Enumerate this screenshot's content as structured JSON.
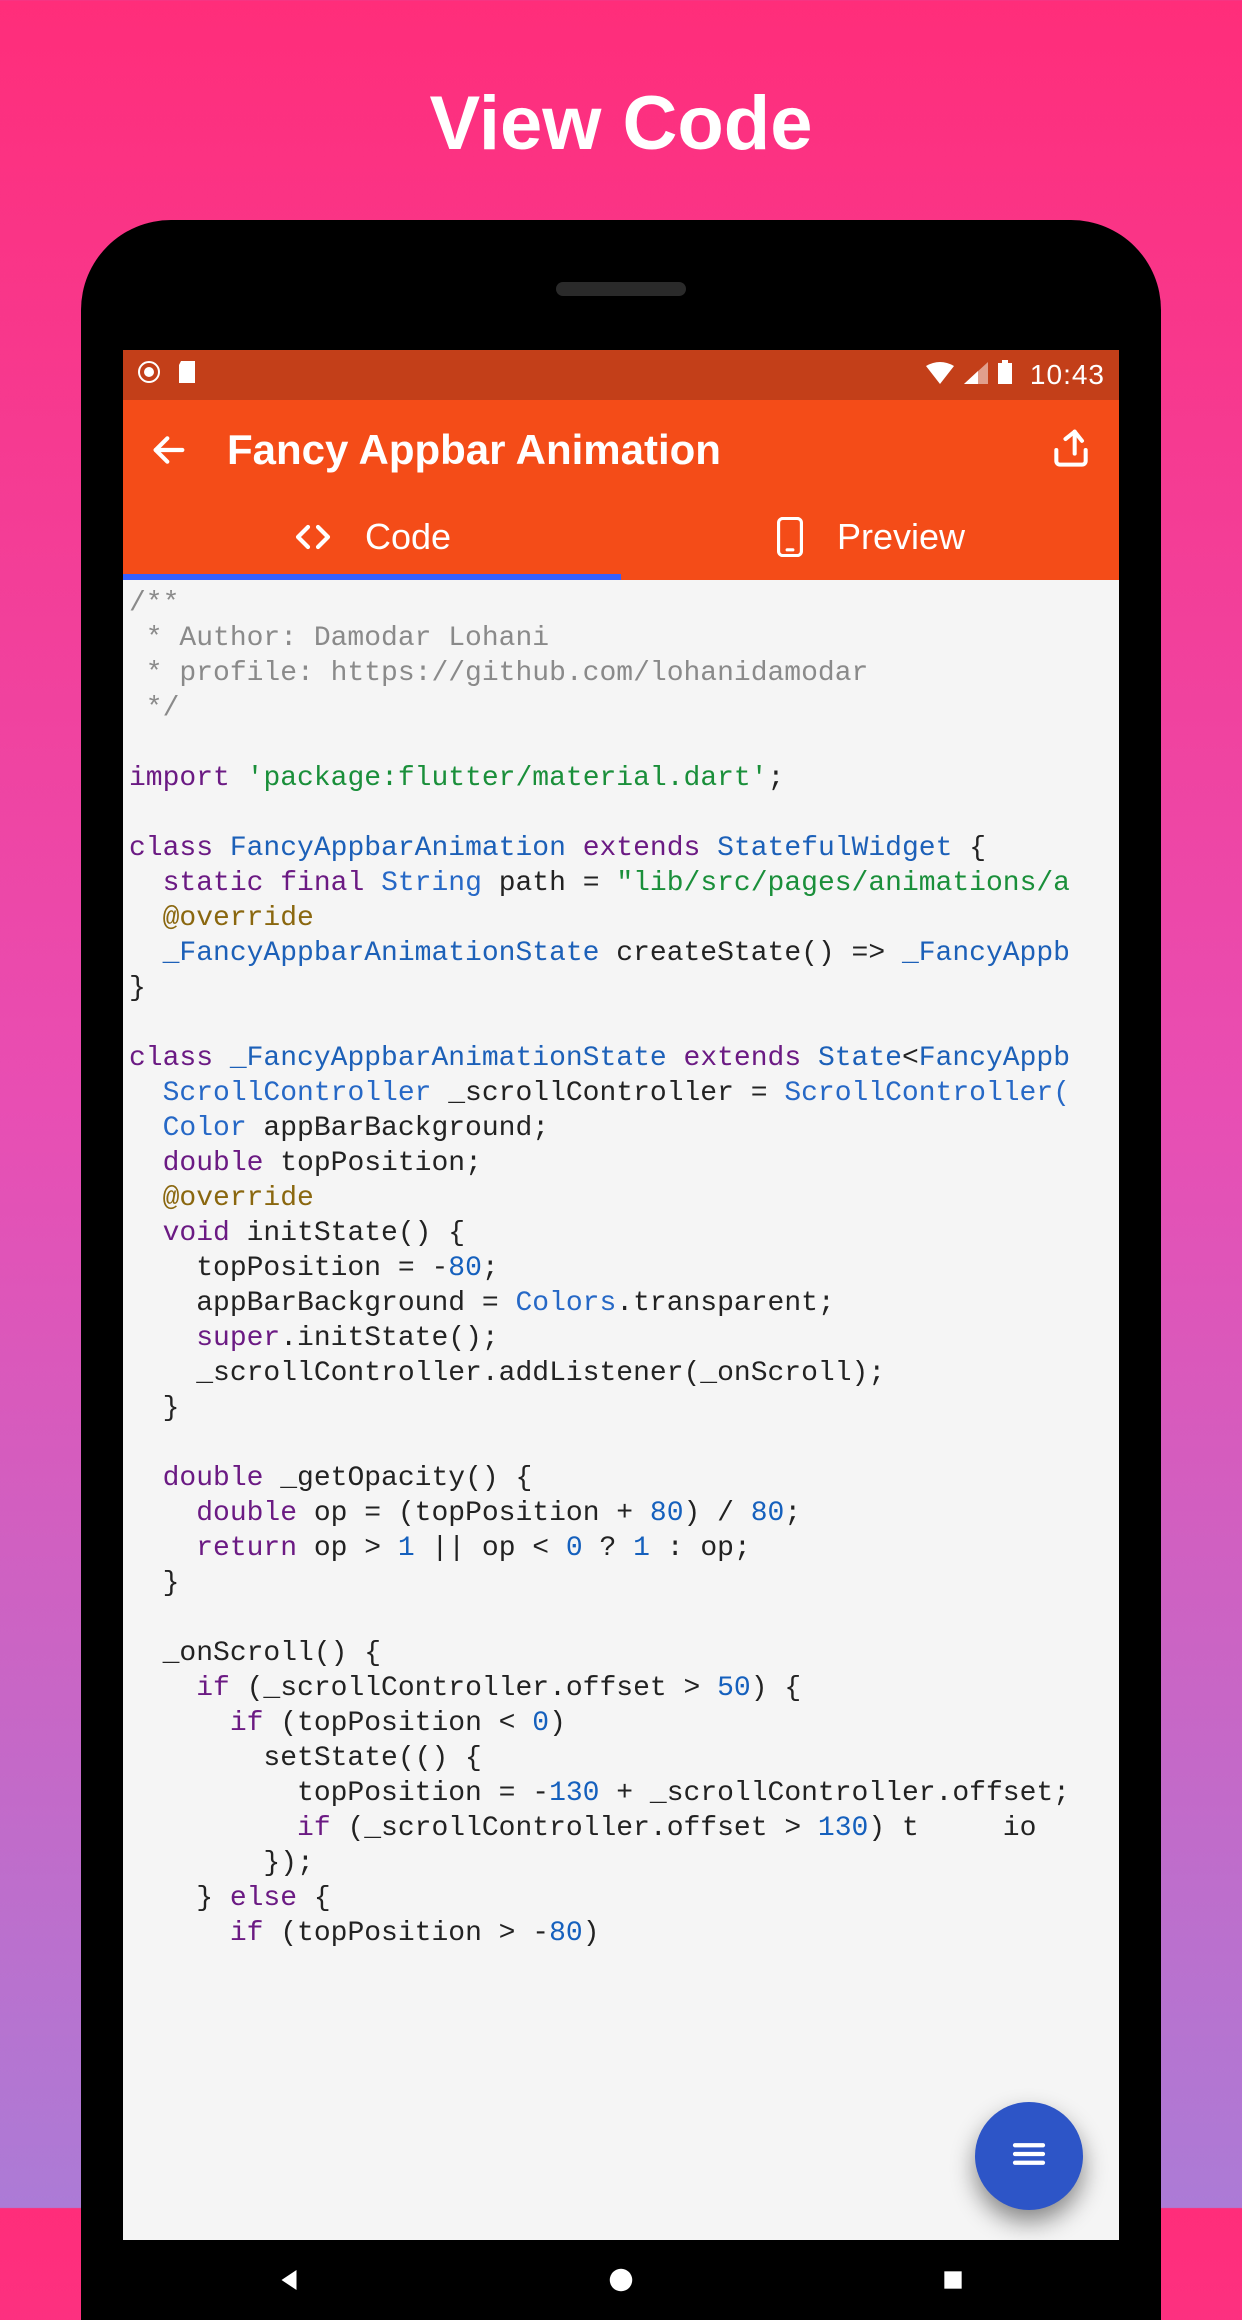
{
  "pageTitle": "View Code",
  "status": {
    "time": "10:43"
  },
  "appbar": {
    "title": "Fancy Appbar Animation"
  },
  "tabs": {
    "code": "Code",
    "preview": "Preview"
  },
  "colors": {
    "appbar": "#f44c18",
    "statusbar": "#c33f19",
    "fab": "#2d55c7",
    "tabIndicator": "#3560ff"
  },
  "code": {
    "commentBlock": "/**\n * Author: Damodar Lohani\n * profile: https://github.com/lohanidamodar\n */",
    "importKeyword": "import",
    "importPath": "'package:flutter/material.dart'",
    "class1": {
      "kwClass": "class",
      "name": "FancyAppbarAnimation",
      "kwExtends": "extends",
      "sup": "StatefulWidget",
      "line2_kw": "static final",
      "line2_type": "String",
      "line2_rest": " path = ",
      "line2_str": "\"lib/src/pages/animations/a",
      "override": "@override",
      "line4_a": "_FancyAppbarAnimationState",
      "line4_b": " createState() => ",
      "line4_c": "_FancyAppb"
    },
    "class2": {
      "kwClass": "class",
      "name": "_FancyAppbarAnimationState",
      "kwExtends": "extends",
      "stateA": "State",
      "stateB": "<",
      "stateC": "FancyAppb",
      "sc1_a": "ScrollController",
      "sc1_b": " _scrollController = ",
      "sc1_c": "ScrollController(",
      "line2_a": "Color",
      "line2_b": " appBarBackground;",
      "line3_a": "double",
      "line3_b": " topPosition;",
      "override": "@override",
      "init_kw": "void",
      "init_sig": " initState() {",
      "init_l1a": "    topPosition = -",
      "init_l1n": "80",
      "init_l1b": ";",
      "init_l2a": "    appBarBackground = ",
      "init_l2b": "Colors",
      "init_l2c": ".transparent;",
      "init_l3_kw": "super",
      "init_l3_b": ".initState();",
      "init_l4": "    _scrollController.addListener(_onScroll);",
      "init_close": "  }",
      "gop_a": "double",
      "gop_b": " _getOpacity() {",
      "gop_l1_a": "double",
      "gop_l1_b": " op = (topPosition + ",
      "gop_l1_n1": "80",
      "gop_l1_c": ") / ",
      "gop_l1_n2": "80",
      "gop_l1_d": ";",
      "gop_l2_kw": "return",
      "gop_l2_a": " op > ",
      "gop_l2_n1": "1",
      "gop_l2_b": " || op < ",
      "gop_l2_n2": "0",
      "gop_l2_c": " ? ",
      "gop_l2_n3": "1",
      "gop_l2_d": " : op;",
      "gop_close": "  }",
      "ons_sig": "  _onScroll() {",
      "ons_l1_kw": "if",
      "ons_l1_a": " (_scrollController.offset > ",
      "ons_l1_n": "50",
      "ons_l1_b": ") {",
      "ons_l2_kw": "if",
      "ons_l2_a": " (topPosition < ",
      "ons_l2_n": "0",
      "ons_l2_b": ")",
      "ons_l3": "        setState(() {",
      "ons_l4_a": "          topPosition = -",
      "ons_l4_n": "130",
      "ons_l4_b": " + _scrollController.offset;",
      "ons_l5_kw": "if",
      "ons_l5_a": " (_scrollController.offset > ",
      "ons_l5_n": "130",
      "ons_l5_b": ") t     io",
      "ons_l6": "        });",
      "ons_l7a": "    } ",
      "ons_l7_kw": "else",
      "ons_l7b": " {",
      "ons_l8_kw": "if",
      "ons_l8_a": " (topPosition > -",
      "ons_l8_n": "80",
      "ons_l8_b": ")"
    }
  }
}
